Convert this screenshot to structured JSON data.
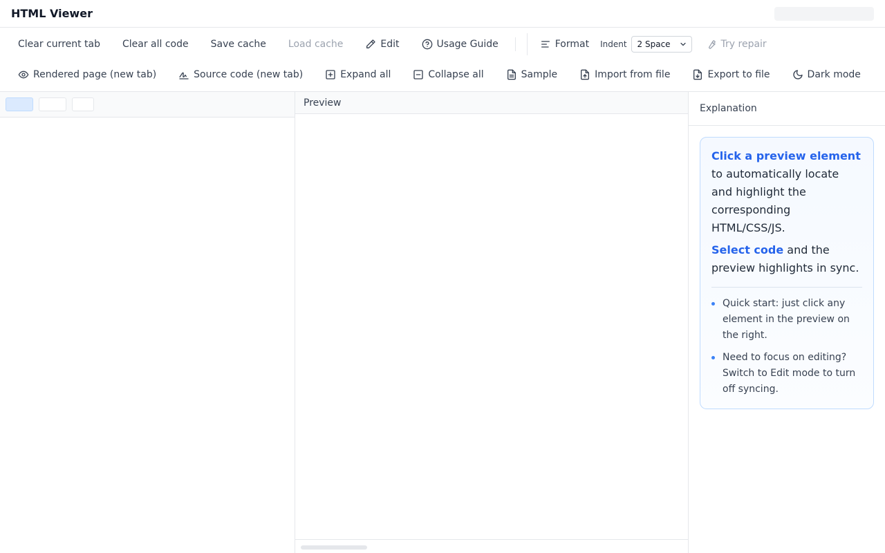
{
  "app": {
    "title": "HTML Viewer"
  },
  "toolbar": {
    "row1": {
      "clear_current_tab": "Clear current tab",
      "clear_all_code": "Clear all code",
      "save_cache": "Save cache",
      "load_cache": "Load cache",
      "edit": "Edit",
      "usage_guide": "Usage Guide",
      "format": "Format",
      "indent_label": "Indent",
      "indent_value": "2 Space",
      "try_repair": "Try repair"
    },
    "row2": {
      "rendered_page": "Rendered page (new tab)",
      "source_code": "Source code (new tab)",
      "expand_all": "Expand all",
      "collapse_all": "Collapse all",
      "sample": "Sample",
      "import_from_file": "Import from file",
      "export_to_file": "Export to file",
      "dark_mode": "Dark mode"
    }
  },
  "preview": {
    "header": "Preview"
  },
  "explanation": {
    "header": "Explanation",
    "p1_highlight": "Click a preview element",
    "p1_rest": " to automatically locate and highlight the corresponding HTML/CSS/JS.",
    "p2_highlight": "Select code",
    "p2_rest": " and the preview highlights in sync.",
    "tips": [
      "Quick start: just click any element in the preview on the right.",
      "Need to focus on editing? Switch to Edit mode to turn off syncing."
    ]
  },
  "colors": {
    "accent": "#2563eb",
    "card_border": "#bfdbfe",
    "active_tab": "#dbeafe"
  },
  "icons": [
    "pencil-icon",
    "help-circle-icon",
    "align-left-icon",
    "chevron-down-icon",
    "wrench-icon",
    "eye-icon",
    "signature-icon",
    "plus-square-icon",
    "minus-square-icon",
    "file-text-icon",
    "file-import-icon",
    "file-export-icon",
    "moon-icon"
  ]
}
